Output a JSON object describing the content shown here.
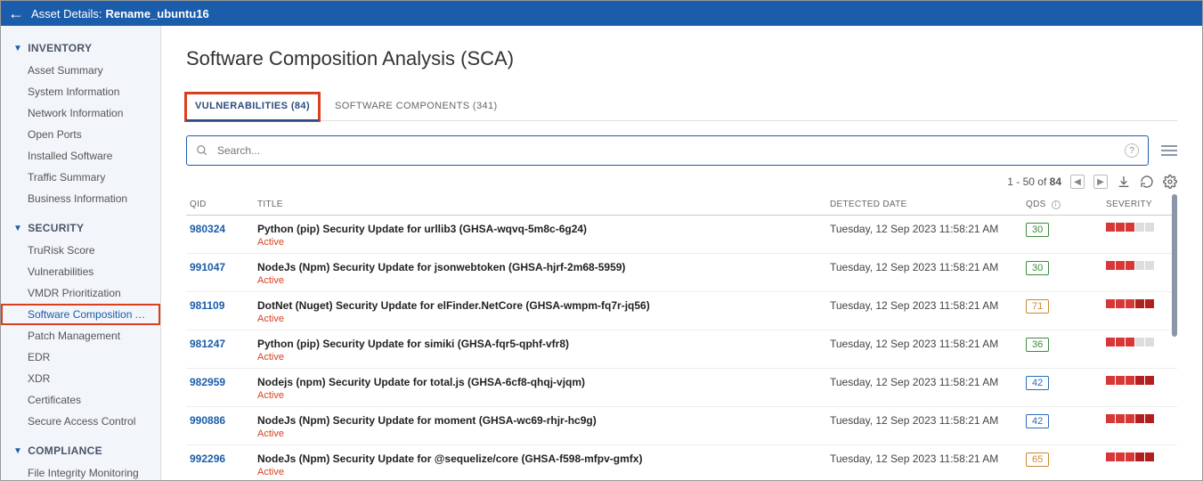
{
  "header": {
    "label": "Asset Details:",
    "name": "Rename_ubuntu16"
  },
  "sidebar": {
    "sections": [
      {
        "title": "INVENTORY",
        "items": [
          "Asset Summary",
          "System Information",
          "Network Information",
          "Open Ports",
          "Installed Software",
          "Traffic Summary",
          "Business Information"
        ]
      },
      {
        "title": "SECURITY",
        "items": [
          "TruRisk Score",
          "Vulnerabilities",
          "VMDR Prioritization",
          "Software Composition Analy...",
          "Patch Management",
          "EDR",
          "XDR",
          "Certificates",
          "Secure Access Control"
        ],
        "active_index": 3
      },
      {
        "title": "COMPLIANCE",
        "items": [
          "File Integrity Monitoring"
        ]
      }
    ]
  },
  "page": {
    "title": "Software Composition Analysis (SCA)"
  },
  "tabs": [
    {
      "label": "VULNERABILITIES (84)",
      "active": true
    },
    {
      "label": "SOFTWARE COMPONENTS (341)",
      "active": false
    }
  ],
  "search": {
    "placeholder": "Search..."
  },
  "pager": {
    "text_prefix": "1 - 50 of ",
    "total": "84"
  },
  "columns": {
    "qid": "QID",
    "title": "TITLE",
    "date": "DETECTED DATE",
    "qds": "QDS",
    "severity": "SEVERITY"
  },
  "rows": [
    {
      "qid": "980324",
      "title": "Python (pip) Security Update for urllib3 (GHSA-wqvq-5m8c-6g24)",
      "status": "Active",
      "date": "Tuesday, 12 Sep 2023 11:58:21 AM",
      "qds": "30",
      "qds_color": "#3a8c3a",
      "sev": 3
    },
    {
      "qid": "991047",
      "title": "NodeJs (Npm) Security Update for jsonwebtoken (GHSA-hjrf-2m68-5959)",
      "status": "Active",
      "date": "Tuesday, 12 Sep 2023 11:58:21 AM",
      "qds": "30",
      "qds_color": "#3a8c3a",
      "sev": 3
    },
    {
      "qid": "981109",
      "title": "DotNet (Nuget) Security Update for elFinder.NetCore (GHSA-wmpm-fq7r-jq56)",
      "status": "Active",
      "date": "Tuesday, 12 Sep 2023 11:58:21 AM",
      "qds": "71",
      "qds_color": "#c98a30",
      "sev": 5
    },
    {
      "qid": "981247",
      "title": "Python (pip) Security Update for simiki (GHSA-fqr5-qphf-vfr8)",
      "status": "Active",
      "date": "Tuesday, 12 Sep 2023 11:58:21 AM",
      "qds": "36",
      "qds_color": "#3a8c3a",
      "sev": 3
    },
    {
      "qid": "982959",
      "title": "Nodejs (npm) Security Update for total.js (GHSA-6cf8-qhqj-vjqm)",
      "status": "Active",
      "date": "Tuesday, 12 Sep 2023 11:58:21 AM",
      "qds": "42",
      "qds_color": "#2a6bbf",
      "sev": 5
    },
    {
      "qid": "990886",
      "title": "NodeJs (Npm) Security Update for moment (GHSA-wc69-rhjr-hc9g)",
      "status": "Active",
      "date": "Tuesday, 12 Sep 2023 11:58:21 AM",
      "qds": "42",
      "qds_color": "#2a6bbf",
      "sev": 5
    },
    {
      "qid": "992296",
      "title": "NodeJs (Npm) Security Update for @sequelize/core (GHSA-f598-mfpv-gmfx)",
      "status": "Active",
      "date": "Tuesday, 12 Sep 2023 11:58:21 AM",
      "qds": "65",
      "qds_color": "#c98a30",
      "sev": 5
    }
  ]
}
